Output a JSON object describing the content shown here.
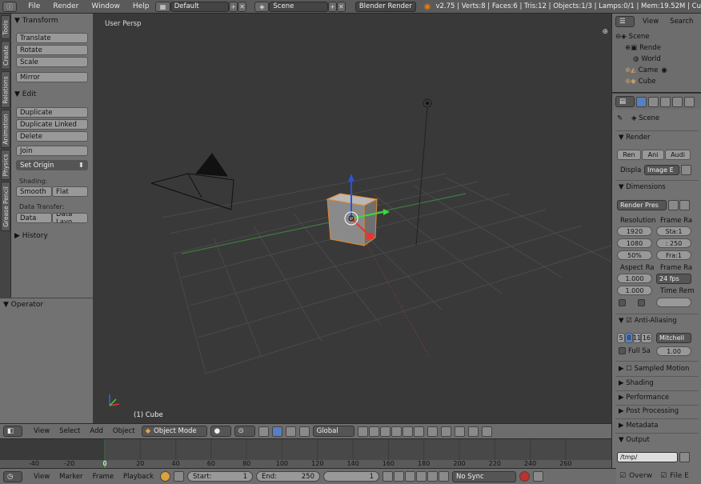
{
  "topbar": {
    "menus": [
      "File",
      "Render",
      "Window",
      "Help"
    ],
    "layout": "Default",
    "scene": "Scene",
    "engine": "Blender Render",
    "stats": "v2.75 | Verts:8 | Faces:6 | Tris:12 | Objects:1/3 | Lamps:0/1 | Mem:19.52M | Cu"
  },
  "tabs": [
    "Tools",
    "Create",
    "Relations",
    "Animation",
    "Physics",
    "Grease Pencil"
  ],
  "tools": {
    "transform": "Transform",
    "translate": "Translate",
    "rotate": "Rotate",
    "scale": "Scale",
    "mirror": "Mirror",
    "edit": "Edit",
    "duplicate": "Duplicate",
    "duplicate_linked": "Duplicate Linked",
    "delete": "Delete",
    "join": "Join",
    "set_origin": "Set Origin",
    "shading": "Shading:",
    "smooth": "Smooth",
    "flat": "Flat",
    "data_transfer": "Data Transfer:",
    "data": "Data",
    "data_layo": "Data Layo",
    "history": "History"
  },
  "operator": "Operator",
  "viewport": {
    "label": "User Persp",
    "object": "(1) Cube"
  },
  "vp_header": {
    "menus": [
      "View",
      "Select",
      "Add",
      "Object"
    ],
    "mode": "Object Mode",
    "orientation": "Global"
  },
  "timeline": {
    "ticks": [
      "-40",
      "-20",
      "0",
      "20",
      "40",
      "60",
      "80",
      "100",
      "120",
      "140",
      "160",
      "180",
      "200",
      "220",
      "240",
      "260"
    ]
  },
  "tl_header": {
    "menus": [
      "View",
      "Marker",
      "Frame",
      "Playback"
    ],
    "start_label": "Start:",
    "start": "1",
    "end_label": "End:",
    "end": "250",
    "current": "1",
    "sync": "No Sync"
  },
  "outliner": {
    "view": "View",
    "search": "Search",
    "items": [
      "Scene",
      "RenderLayers",
      "World",
      "Camera",
      "Cube"
    ],
    "item_display": [
      "Scene",
      "Rende",
      "World",
      "Came",
      "Cube"
    ]
  },
  "props": {
    "scene": "Scene",
    "render": "Render",
    "ren": "Ren",
    "ani": "Ani",
    "audi": "Audi",
    "displa": "Displa",
    "image_e": "Image E",
    "dimensions": "Dimensions",
    "render_pres": "Render Pres",
    "resolution": "Resolution",
    "frame_ra": "Frame Ra",
    "res_x": "1920",
    "res_y": "1080",
    "res_pct": "50%",
    "sta": "Sta:1",
    "end": ": 250",
    "fra": "Fra:1",
    "aspect_ra": "Aspect Ra",
    "frame_ra2": "Frame Ra",
    "asp_x": "1.000",
    "asp_y": "1.000",
    "fps": "24 fps",
    "time_rem": "Time Rem",
    "anti_aliasing": "Anti-Aliasing",
    "aa": [
      "5",
      "8",
      "11",
      "16"
    ],
    "mitchell": "Mitchell",
    "full_sa": "Full Sa",
    "full_val": "1.00",
    "sampled_motion": "Sampled Motion",
    "shading": "Shading",
    "performance": "Performance",
    "post_processing": "Post Processing",
    "metadata": "Metadata",
    "output": "Output",
    "out_path": "/tmp/",
    "overw": "Overw",
    "file_e": "File E"
  }
}
